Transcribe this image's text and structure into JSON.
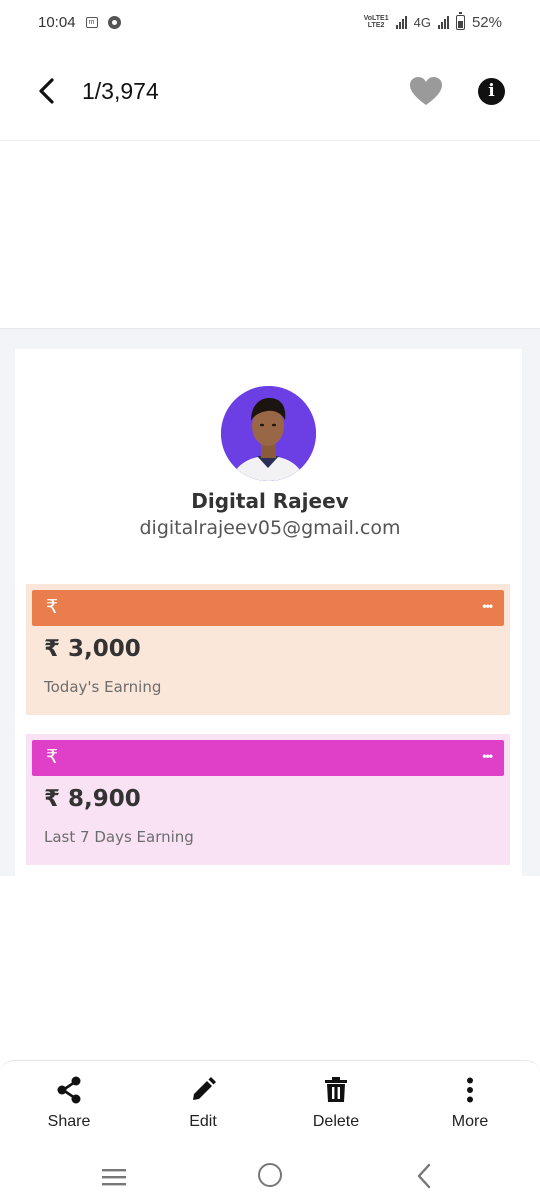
{
  "status_bar": {
    "time": "10:04",
    "volte_top": "VoLTE1",
    "volte_bottom": "LTE2",
    "network": "4G",
    "battery": "52%"
  },
  "viewer": {
    "counter": "1/3,974"
  },
  "profile": {
    "name": "Digital Rajeev",
    "email": "digitalrajeev05@gmail.com"
  },
  "earnings": [
    {
      "icon": "₹",
      "amount": "₹ 3,000",
      "label": "Today's Earning",
      "bar_color": "#e97d4d",
      "bg_color": "#fbe6da"
    },
    {
      "icon": "₹",
      "amount": "₹ 8,900",
      "label": "Last 7 Days Earning",
      "bar_color": "#e040c8",
      "bg_color": "#f9e2f4"
    }
  ],
  "actions": {
    "share": "Share",
    "edit": "Edit",
    "delete": "Delete",
    "more": "More"
  }
}
